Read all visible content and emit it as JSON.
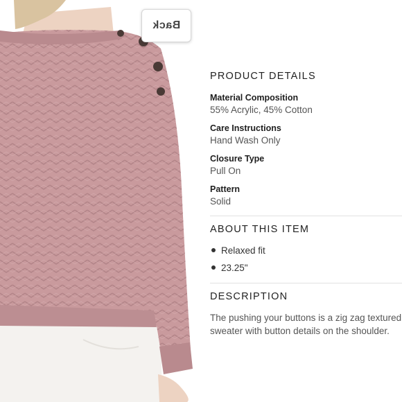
{
  "back_button": {
    "label": "Back"
  },
  "product_details": {
    "heading": "PRODUCT DETAILS",
    "rows": [
      {
        "label": "Material Composition",
        "value": "55% Acrylic, 45% Cotton"
      },
      {
        "label": "Care Instructions",
        "value": "Hand Wash Only"
      },
      {
        "label": "Closure Type",
        "value": "Pull On"
      },
      {
        "label": "Pattern",
        "value": "Solid"
      }
    ]
  },
  "about": {
    "heading": "ABOUT THIS ITEM",
    "bullets": [
      "Relaxed fit",
      "23.25\""
    ]
  },
  "description": {
    "heading": "DESCRIPTION",
    "text": "The pushing your buttons is a zig zag textured sweater with button details on the shoulder."
  },
  "colors": {
    "sweater": "#c99a9d",
    "pants": "#f4f2ef",
    "skin": "#edd3c2",
    "button": "#4a3a36"
  }
}
